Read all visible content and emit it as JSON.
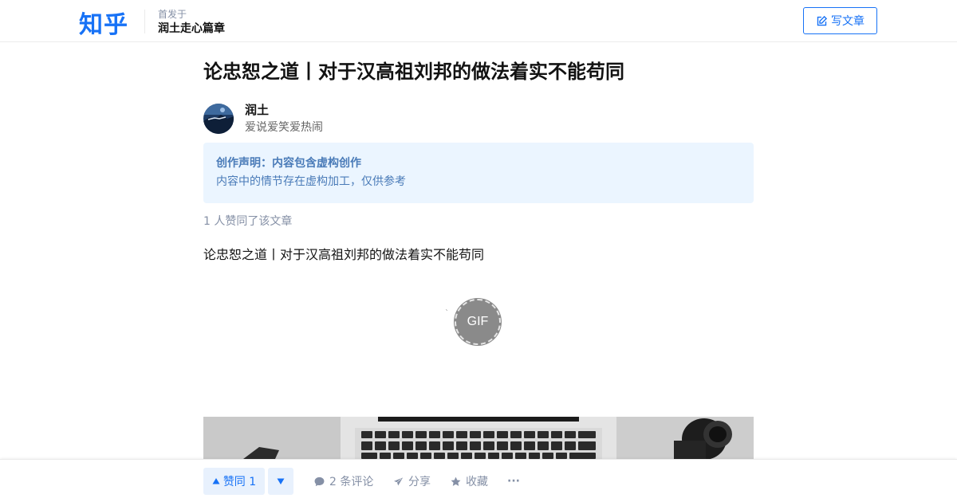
{
  "header": {
    "logo": "知乎",
    "published_prefix": "首发于",
    "column_name": "润土走心篇章",
    "write_label": "写文章",
    "write_icon": "edit-icon"
  },
  "article": {
    "title": "论忠恕之道丨对于汉高祖刘邦的做法着实不能苟同",
    "author": {
      "name": "润土",
      "bio": "爱说爱笑爱热闹"
    },
    "notice": {
      "title": "创作声明：内容包含虚构创作",
      "desc": "内容中的情节存在虚构加工，仅供参考"
    },
    "voters_text": "1 人赞同了该文章",
    "paragraph": "论忠恕之道丨对于汉高祖刘邦的做法着实不能苟同",
    "gif_label": "GIF",
    "gif_tick": "`"
  },
  "actions": {
    "upvote_label": "赞同 1",
    "comments_label": "2 条评论",
    "share_label": "分享",
    "favorite_label": "收藏",
    "more_label": "···"
  },
  "colors": {
    "brand": "#1772f6",
    "notice_bg": "#ebf5ff",
    "muted": "#8590a6"
  }
}
